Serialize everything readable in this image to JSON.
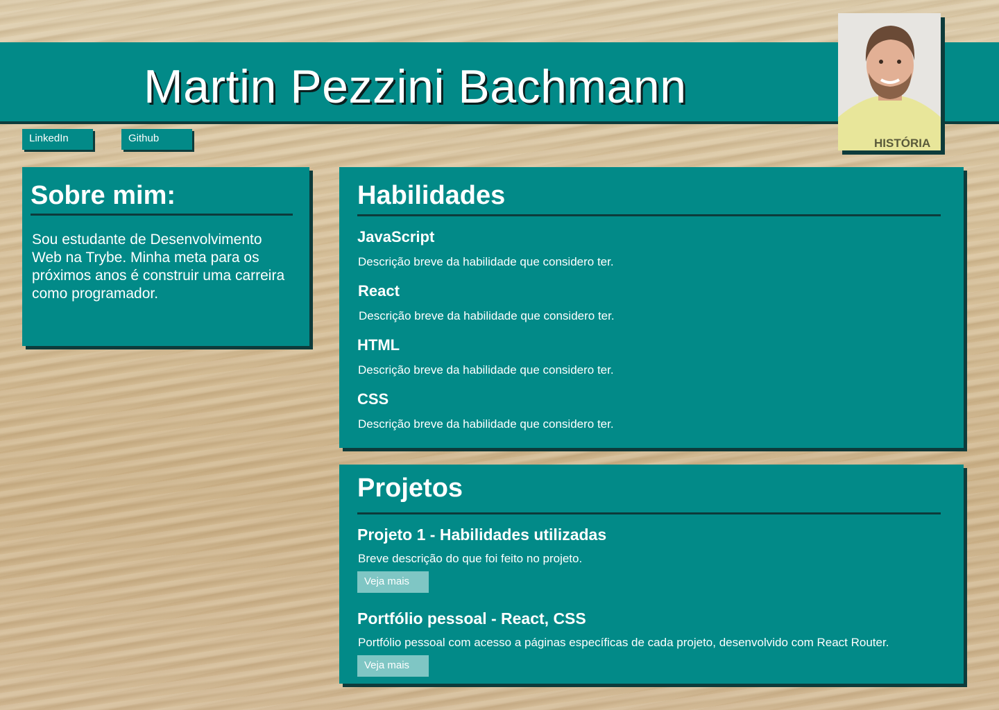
{
  "header": {
    "name": "Martin Pezzini Bachmann"
  },
  "social": {
    "linkedin_label": "LinkedIn",
    "github_label": "Github"
  },
  "about": {
    "title": "Sobre mim:",
    "text": "Sou estudante de Desenvolvimento Web na Trybe. Minha meta para os próximos anos é construir uma carreira como programador."
  },
  "skills": {
    "title": "Habilidades",
    "items": [
      {
        "name": "JavaScript",
        "desc": "Descrição breve da habilidade que considero ter."
      },
      {
        "name": "React",
        "desc": "Descrição breve da habilidade que considero ter."
      },
      {
        "name": "HTML",
        "desc": "Descrição breve da habilidade que considero ter."
      },
      {
        "name": "CSS",
        "desc": "Descrição breve da habilidade que considero ter."
      }
    ]
  },
  "projects": {
    "title": "Projetos",
    "items": [
      {
        "name": "Projeto 1 - Habilidades utilizadas",
        "desc": "Breve descrição do que foi feito no projeto.",
        "button": "Veja mais"
      },
      {
        "name": "Portfólio pessoal - React, CSS",
        "desc": "Portfólio pessoal com acesso a páginas específicas de cada projeto, desenvolvido com React Router.",
        "button": "Veja mais"
      }
    ]
  },
  "photo": {
    "shirt_text": "HISTÓRIA"
  },
  "colors": {
    "teal": "#028a88",
    "shadow": "#0d3b3b",
    "button_light": "#7fc6c4"
  }
}
